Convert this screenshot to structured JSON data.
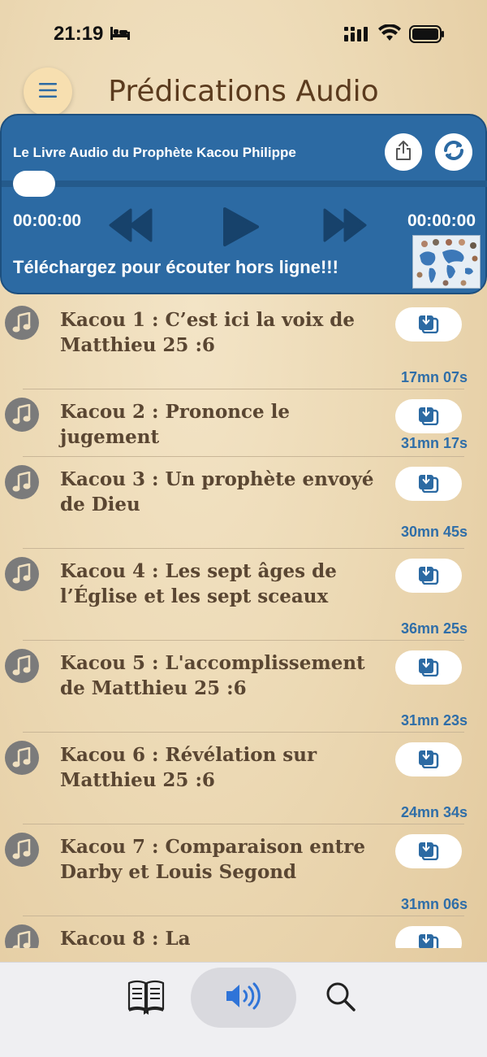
{
  "status_bar": {
    "time": "21:19"
  },
  "header": {
    "title": "Prédications Audio"
  },
  "player": {
    "title": "Le Livre Audio du Prophète Kacou Philippe",
    "elapsed": "00:00:00",
    "remaining": "00:00:00",
    "progress": 0,
    "offline_message": "Téléchargez pour écouter hors ligne!!!"
  },
  "sermons": [
    {
      "title": "Kacou 1 : C’est ici la voix de Matthieu 25 :6",
      "duration": "17mn 07s"
    },
    {
      "title": "Kacou 2 : Prononce le jugement",
      "duration": "31mn 17s"
    },
    {
      "title": "Kacou 3 : Un prophète envoyé de Dieu",
      "duration": "30mn 45s"
    },
    {
      "title": "Kacou 4 : Les sept âges de l’Église et les sept sceaux",
      "duration": "36mn 25s"
    },
    {
      "title": "Kacou 5 : L'accomplissement de Matthieu 25 :6",
      "duration": "31mn 23s"
    },
    {
      "title": "Kacou 6 : Révélation sur Matthieu 25 :6",
      "duration": "24mn 34s"
    },
    {
      "title": "Kacou 7 : Comparaison entre Darby et Louis Segond",
      "duration": "31mn 06s"
    },
    {
      "title": "Kacou 8 : La",
      "duration": ""
    }
  ],
  "tabs": [
    {
      "icon": "book-icon",
      "active": false
    },
    {
      "icon": "speaker-icon",
      "active": true
    },
    {
      "icon": "search-icon",
      "active": false
    }
  ],
  "colors": {
    "accent": "#2c6aa3",
    "title_brown": "#5b3b1e",
    "duration_blue": "#2f6ea8"
  }
}
